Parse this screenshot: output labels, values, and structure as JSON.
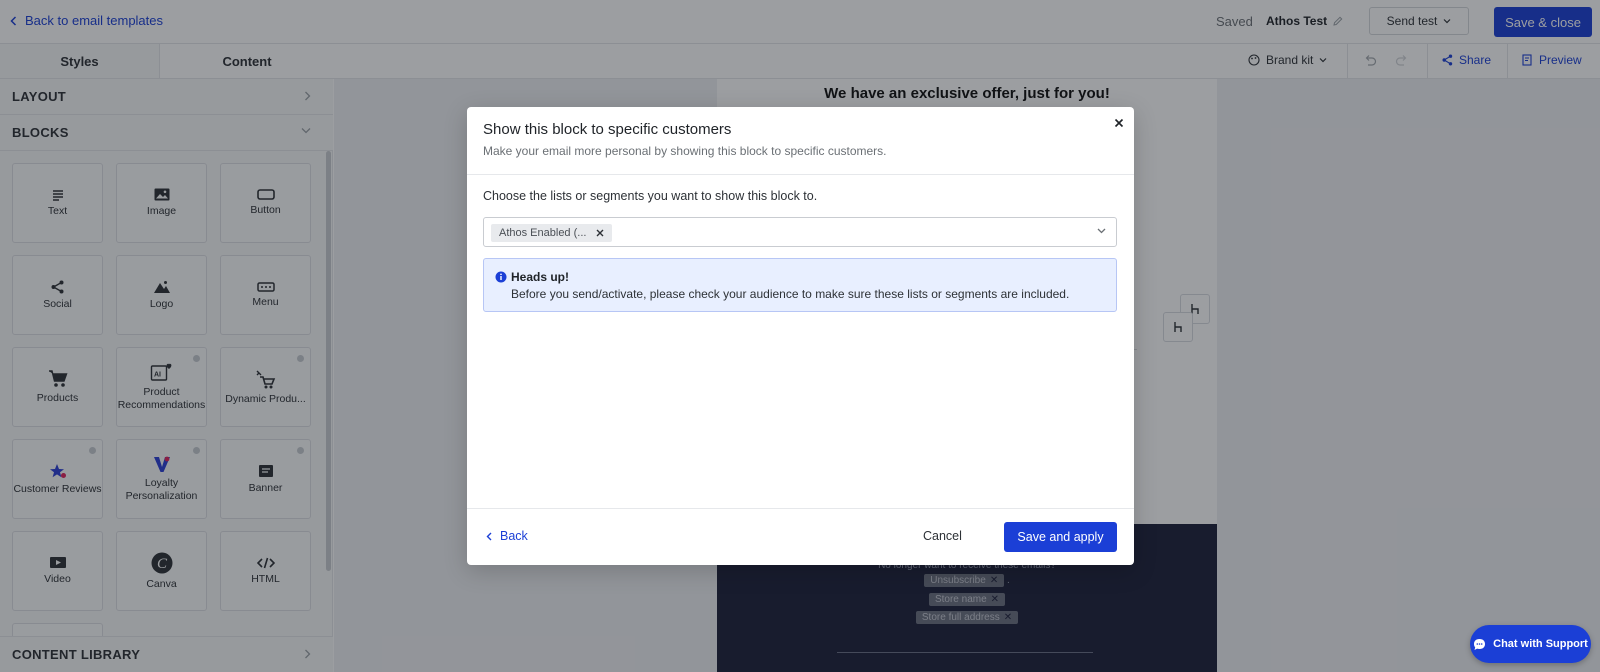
{
  "topbar": {
    "back_label": "Back to email templates",
    "saved_label": "Saved",
    "template_name": "Athos Test",
    "send_test_label": "Send test",
    "save_close_label": "Save & close"
  },
  "subbar": {
    "tabs": [
      {
        "label": "Styles"
      },
      {
        "label": "Content"
      }
    ],
    "brand_kit_label": "Brand kit",
    "share_label": "Share",
    "preview_label": "Preview"
  },
  "sidebar": {
    "layout_label": "LAYOUT",
    "blocks_label": "BLOCKS",
    "content_library_label": "CONTENT LIBRARY",
    "blocks": [
      {
        "label": "Text",
        "icon": "text-icon"
      },
      {
        "label": "Image",
        "icon": "image-icon"
      },
      {
        "label": "Button",
        "icon": "button-icon"
      },
      {
        "label": "Social",
        "icon": "share-icon"
      },
      {
        "label": "Logo",
        "icon": "logo-icon"
      },
      {
        "label": "Menu",
        "icon": "menu-icon"
      },
      {
        "label": "Products",
        "icon": "cart-icon"
      },
      {
        "label": "Product Recommendations",
        "icon": "ai-heart-icon"
      },
      {
        "label": "Dynamic Produ...",
        "icon": "dynamic-cart-icon"
      },
      {
        "label": "Customer Reviews",
        "icon": "reviews-star-icon"
      },
      {
        "label": "Loyalty Personalization",
        "icon": "loyalty-icon"
      },
      {
        "label": "Banner",
        "icon": "banner-icon"
      },
      {
        "label": "Video",
        "icon": "video-icon"
      },
      {
        "label": "Canva",
        "icon": "canva-icon"
      },
      {
        "label": "HTML",
        "icon": "code-icon"
      }
    ]
  },
  "email": {
    "headline": "We have an exclusive offer, just for you!",
    "footer_line": "No longer want to receive these emails?",
    "unsubscribe_chip": "Unsubscribe",
    "store_name_chip": "Store name",
    "store_address_chip": "Store full address"
  },
  "modal": {
    "title": "Show this block to specific customers",
    "subtitle": "Make your email more personal by showing this block to specific customers.",
    "prompt": "Choose the lists or segments you want to show this block to.",
    "selected_tag": "Athos Enabled (...",
    "alert_heading": "Heads up!",
    "alert_body": "Before you send/activate, please check your audience to make sure these lists or segments are included.",
    "back_label": "Back",
    "cancel_label": "Cancel",
    "save_label": "Save and apply"
  },
  "chat": {
    "label": "Chat with Support"
  },
  "colors": {
    "accent": "#1b3fd6",
    "alert_bg": "#e8efff",
    "footer_bg": "#1c1f3a"
  }
}
